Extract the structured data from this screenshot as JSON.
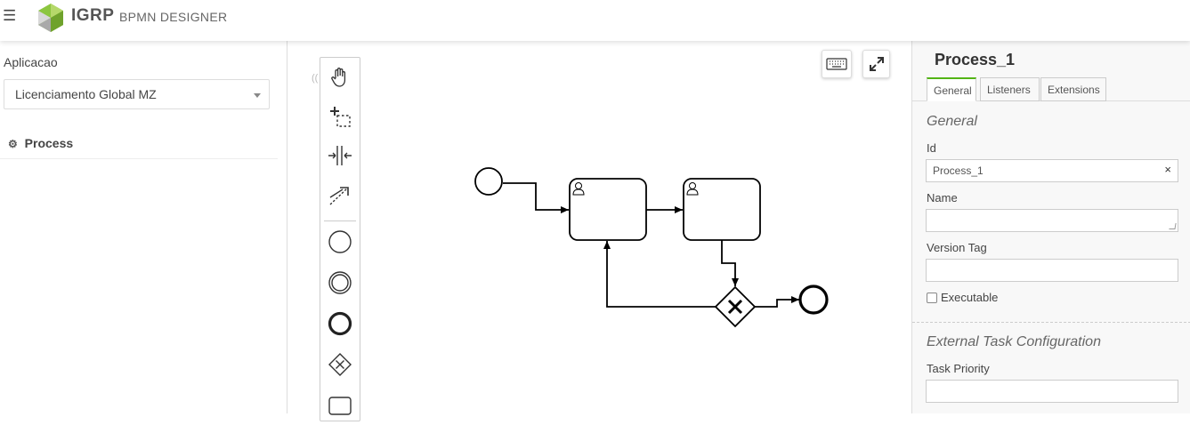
{
  "header": {
    "brand": "IGRP",
    "subtitle": "BPMN DESIGNER"
  },
  "sidebar": {
    "app_label": "Aplicacao",
    "app_selected": "Licenciamento Global MZ",
    "process_label": "Process"
  },
  "canvas": {
    "palette_tools": [
      "hand-tool",
      "lasso-tool",
      "space-tool",
      "global-connect-tool",
      "start-event",
      "intermediate-event",
      "end-event",
      "gateway",
      "task"
    ],
    "side_marker": "(("
  },
  "properties": {
    "title": "Process_1",
    "tabs": [
      "General",
      "Listeners",
      "Extensions"
    ],
    "active_tab": "General",
    "general_group": "General",
    "id_label": "Id",
    "id_value": "Process_1",
    "clear_symbol": "×",
    "name_label": "Name",
    "name_value": "",
    "version_label": "Version Tag",
    "version_value": "",
    "executable_label": "Executable",
    "external_group": "External Task Configuration",
    "priority_label": "Task Priority",
    "priority_value": ""
  },
  "colors": {
    "accent_green": "#52b415",
    "logo_green": "#8cc63f"
  }
}
